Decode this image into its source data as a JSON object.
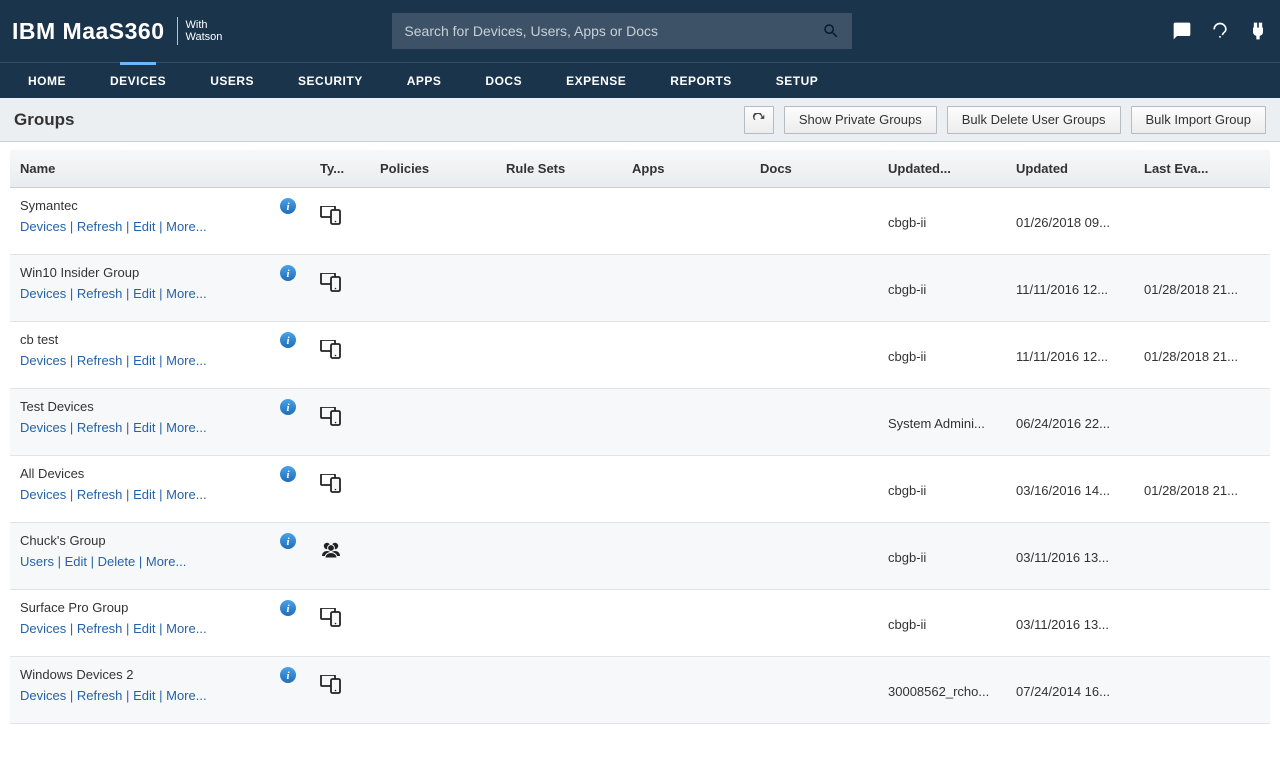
{
  "header": {
    "logo_main": "IBM MaaS360",
    "logo_sub_top": "With",
    "logo_sub_bottom": "Watson",
    "search_placeholder": "Search for Devices, Users, Apps or Docs"
  },
  "nav": {
    "items": [
      "HOME",
      "DEVICES",
      "USERS",
      "SECURITY",
      "APPS",
      "DOCS",
      "EXPENSE",
      "REPORTS",
      "SETUP"
    ],
    "active_index": 1
  },
  "subheader": {
    "title": "Groups",
    "btn_show_private": "Show Private Groups",
    "btn_bulk_delete": "Bulk Delete User Groups",
    "btn_bulk_import": "Bulk Import Group"
  },
  "columns": {
    "name": "Name",
    "type": "Ty...",
    "policies": "Policies",
    "rule_sets": "Rule Sets",
    "apps": "Apps",
    "docs": "Docs",
    "updated_by": "Updated...",
    "updated": "Updated",
    "last_eval": "Last Eva..."
  },
  "action_labels": {
    "devices": "Devices",
    "users": "Users",
    "refresh": "Refresh",
    "edit": "Edit",
    "delete": "Delete",
    "more": "More..."
  },
  "rows": [
    {
      "name": "Symantec",
      "actions": [
        "devices",
        "refresh",
        "edit"
      ],
      "type": "device",
      "updated_by": "cbgb-ii",
      "updated": "01/26/2018 09...",
      "last_eval": ""
    },
    {
      "name": "Win10 Insider Group",
      "actions": [
        "devices",
        "refresh",
        "edit"
      ],
      "type": "device",
      "updated_by": "cbgb-ii",
      "updated": "11/11/2016 12...",
      "last_eval": "01/28/2018 21..."
    },
    {
      "name": "cb test",
      "actions": [
        "devices",
        "refresh",
        "edit"
      ],
      "type": "device",
      "updated_by": "cbgb-ii",
      "updated": "11/11/2016 12...",
      "last_eval": "01/28/2018 21..."
    },
    {
      "name": "Test Devices",
      "actions": [
        "devices",
        "refresh",
        "edit"
      ],
      "type": "device",
      "updated_by": "System Admini...",
      "updated": "06/24/2016 22...",
      "last_eval": ""
    },
    {
      "name": "All Devices",
      "actions": [
        "devices",
        "refresh",
        "edit"
      ],
      "type": "device",
      "updated_by": "cbgb-ii",
      "updated": "03/16/2016 14...",
      "last_eval": "01/28/2018 21..."
    },
    {
      "name": "Chuck's Group",
      "actions": [
        "users",
        "edit",
        "delete"
      ],
      "type": "user",
      "updated_by": "cbgb-ii",
      "updated": "03/11/2016 13...",
      "last_eval": ""
    },
    {
      "name": "Surface Pro Group",
      "actions": [
        "devices",
        "refresh",
        "edit"
      ],
      "type": "device",
      "updated_by": "cbgb-ii",
      "updated": "03/11/2016 13...",
      "last_eval": ""
    },
    {
      "name": "Windows Devices 2",
      "actions": [
        "devices",
        "refresh",
        "edit"
      ],
      "type": "device",
      "updated_by": "30008562_rcho...",
      "updated": "07/24/2014 16...",
      "last_eval": ""
    }
  ]
}
